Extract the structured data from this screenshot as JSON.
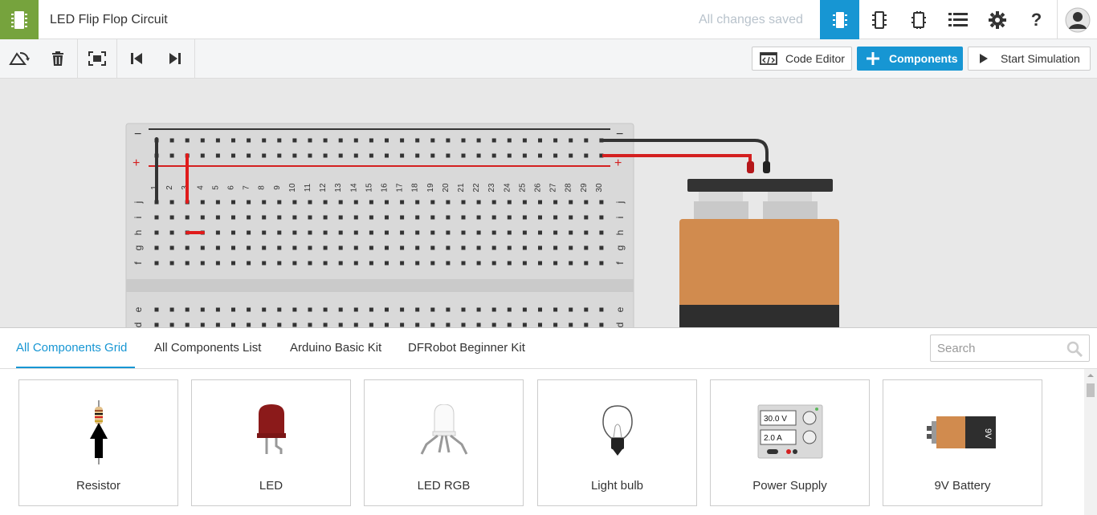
{
  "header": {
    "title": "LED Flip Flop Circuit",
    "save_status": "All changes saved",
    "buttons": [
      "circuit-view-icon",
      "schematic-view-icon",
      "component-list-icon",
      "list-icon",
      "gear-icon",
      "help-icon"
    ],
    "brand_color": "#76a33d",
    "accent_color": "#1796d3"
  },
  "toolbar": {
    "code_editor_label": "Code Editor",
    "components_label": "Components",
    "start_simulation_label": "Start Simulation"
  },
  "breadboard": {
    "row_labels_top": [
      "j",
      "i",
      "h",
      "g",
      "f"
    ],
    "row_labels_bottom": [
      "e",
      "d"
    ],
    "column_numbers": [
      "1",
      "2",
      "3",
      "4",
      "5",
      "6",
      "7",
      "8",
      "9",
      "10",
      "11",
      "12",
      "13",
      "14",
      "15",
      "16",
      "17",
      "18",
      "19",
      "20",
      "21",
      "22",
      "23",
      "24",
      "25",
      "26",
      "27",
      "28",
      "29",
      "30"
    ],
    "minus_symbol": "−",
    "plus_symbol": "+"
  },
  "panel": {
    "tabs": [
      "All Components Grid",
      "All Components List",
      "Arduino Basic Kit",
      "DFRobot Beginner Kit"
    ],
    "search_placeholder": "Search",
    "components": [
      {
        "label": "Resistor",
        "icon": "resistor-icon"
      },
      {
        "label": "LED",
        "icon": "led-icon"
      },
      {
        "label": "LED RGB",
        "icon": "led-rgb-icon"
      },
      {
        "label": "Light bulb",
        "icon": "light-bulb-icon"
      },
      {
        "label": "Power Supply",
        "icon": "power-supply-icon",
        "readout_voltage": "30.0 V",
        "readout_current": "2.0 A"
      },
      {
        "label": "9V Battery",
        "icon": "battery-9v-icon",
        "battery_text": "9V"
      }
    ]
  }
}
